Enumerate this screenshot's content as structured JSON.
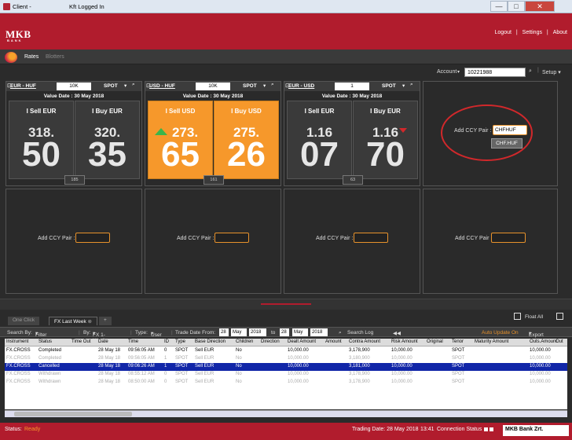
{
  "window": {
    "title": "Client -",
    "subtitle": "Kft Logged In",
    "minimize": "—",
    "maximize": "□",
    "close": "✕"
  },
  "header": {
    "logo": "MKB",
    "logo_sub": "BANK",
    "links": [
      "Logout",
      "|",
      "Settings",
      "|",
      "About"
    ]
  },
  "subnav": {
    "tabs": [
      "Rates",
      "Blotters"
    ]
  },
  "account": {
    "label": "Account",
    "value": "10221988",
    "search_icon": "search-icon",
    "setup": "Setup"
  },
  "tiles": [
    {
      "pair": "EUR - HUF",
      "amount": "10K",
      "tenor": "SPOT",
      "value_date": "Value Date : 30 May 2018",
      "sell_label": "I Sell EUR",
      "buy_label": "I Buy EUR",
      "sell_small": "318.",
      "sell_big": "50",
      "buy_small": "320.",
      "buy_big": "35",
      "spread": "185"
    },
    {
      "pair": "USD - HUF",
      "amount": "10K",
      "tenor": "SPOT",
      "value_date": "Value Date : 30 May 2018",
      "sell_label": "I Sell USD",
      "buy_label": "I Buy USD",
      "sell_small": "273.",
      "sell_big": "65",
      "buy_small": "275.",
      "buy_big": "26",
      "spread": "161"
    },
    {
      "pair": "EUR - USD",
      "amount": "1",
      "tenor": "SPOT",
      "value_date": "Value Date : 30 May 2018",
      "sell_label": "I Sell EUR",
      "buy_label": "I Buy EUR",
      "sell_small": "1.16",
      "sell_big": "07",
      "buy_small": "1.16",
      "buy_big": "70",
      "spread": "63"
    }
  ],
  "add_pair": {
    "label": "Add CCY Pair :",
    "typed": "CHFHUF",
    "suggestion": "CHF.HUF"
  },
  "bottom": {
    "tabs": [
      "One Click",
      "FX Last Week",
      "+"
    ],
    "float_all": "Float All",
    "toolbar": {
      "search_by": "Search By:",
      "search_by_val": "Filter",
      "by": "By:",
      "by_val": "FX 1-Week",
      "type": "Type:",
      "type_val": "User",
      "trade_date_from": "Trade Date From:",
      "d1": "28",
      "m1": "May",
      "y1": "2018",
      "to": "to",
      "d2": "28",
      "m2": "May",
      "y2": "2018",
      "search_log": "Search Log",
      "nav": "◀◀",
      "auto_update": "Auto Update On",
      "export": "Export"
    },
    "columns": [
      "Instrument",
      "Status",
      "Time Out",
      "Date",
      "Time",
      "ID",
      "Type",
      "Base Direction",
      "Children",
      "Direction",
      "Dealt Amount",
      "Amount",
      "Contra Amount",
      "Risk Amount",
      "Original",
      "Tenor",
      "Maturity Amount",
      "Outs.Amount",
      "Out"
    ],
    "rows": [
      [
        "FX.CROSS",
        "Completed",
        "",
        "28 May 18",
        "09:56:05 AM",
        "0",
        "SPOT",
        "Sell EUR",
        "No",
        "",
        "10,000.00",
        "",
        "3,178,900",
        "10,000.00",
        "",
        "SPOT",
        "",
        "10,000.00",
        ""
      ],
      [
        "FX.CROSS",
        "Completed",
        "",
        "28 May 18",
        "09:56:05 AM",
        "1",
        "SPOT",
        "Sell EUR",
        "No",
        "",
        "10,000.00",
        "",
        "3,180,900",
        "10,000.00",
        "",
        "SPOT",
        "",
        "10,000.00",
        ""
      ],
      [
        "FX.CROSS",
        "Cancelled",
        "",
        "28 May 18",
        "09:06:26 AM",
        "1",
        "SPOT",
        "Sell EUR",
        "No",
        "",
        "10,000.00",
        "",
        "3,181,000",
        "10,000.00",
        "",
        "SPOT",
        "",
        "10,000.00",
        ""
      ],
      [
        "FX.CROSS",
        "Withdrawn",
        "",
        "28 May 18",
        "08:55:12 AM",
        "0",
        "SPOT",
        "Sell EUR",
        "No",
        "",
        "10,000.00",
        "",
        "3,178,900",
        "10,000.00",
        "",
        "SPOT",
        "",
        "10,000.00",
        ""
      ],
      [
        "FX.CROSS",
        "Withdrawn",
        "",
        "28 May 18",
        "08:50:00 AM",
        "0",
        "SPOT",
        "Sell EUR",
        "No",
        "",
        "10,000.00",
        "",
        "3,178,900",
        "10,000.00",
        "",
        "SPOT",
        "",
        "10,000.00",
        ""
      ]
    ]
  },
  "status": {
    "label": "Status:",
    "value": "Ready",
    "trading_date": "Trading Date: 28 May 2018",
    "time": "13:41",
    "connection": "Connection Status",
    "company": "MKB Bank Zrt."
  },
  "colors": {
    "brand": "#b11c2d",
    "orange": "#f6982b",
    "selected_row": "#1126a8",
    "ready": "#f6982b"
  }
}
